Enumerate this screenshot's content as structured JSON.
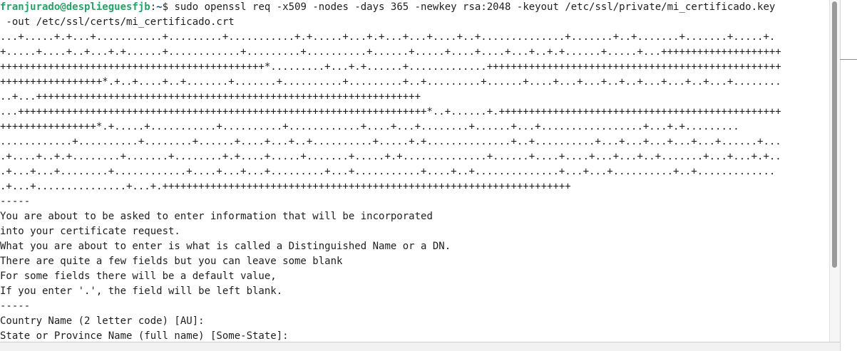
{
  "prompt": {
    "user_host": "franjurado@desplieguesfjb",
    "separator": ":",
    "path": "~",
    "symbol": "$ "
  },
  "command": {
    "line1": "sudo openssl req -x509 -nodes -days 365 -newkey rsa:2048 -keyout /etc/ssl/private/mi_certificado.key",
    "line2": " -out /etc/ssl/certs/mi_certificado.crt"
  },
  "output_lines": [
    "...+.....+.+...+...........+.........+...........+.+.....+...+.+...+...+....+..+..............+.......+..+.......+.......+.....+.",
    "+.....+....+..+...+.+......+............+.........+..........+......+.....+....+....+...+..+.+......+.....+...++++++++++++++++++++",
    "++++++++++++++++++++++++++++++++++++++++++++*.........+...+.+......+.............+++++++++++++++++++++++++++++++++++++++++++++++++",
    "+++++++++++++++++*.+..+....+..+.......+.......+..........+.........+..+.........+......+....+...+...+..+..+...+...+..+...+........",
    "..+...++++++++++++++++++++++++++++++++++++++++++++++++++++++++++++++++",
    "...++++++++++++++++++++++++++++++++++++++++++++++++++++++++++++++++++++*..+......+.+++++++++++++++++++++++++++++++++++++++++++++++",
    "++++++++++++++++*.+.....+...........+..........+............+....+...+........+......+...+.................+...+.+.........",
    "............+..........+........+......+....+...+..+..........+.....+.+..............+..+..........+...+...+...+...+...+......+...",
    ".+....+..+.+........+.......+........+.+....+.....+.......+.....+.+..............+......+....+....+...+...+..+.......+...+...+.+..",
    ".+...+...+........+............+....+...+...+.........+...+...........+....+..+..............+...+...+..........+..+.............",
    ".+...+...............+...+.++++++++++++++++++++++++++++++++++++++++++++++++++++++++++++++++++++",
    "-----",
    "You are about to be asked to enter information that will be incorporated",
    "into your certificate request.",
    "What you are about to enter is what is called a Distinguished Name or a DN.",
    "There are quite a few fields but you can leave some blank",
    "For some fields there will be a default value,",
    "If you enter '.', the field will be left blank.",
    "-----",
    "Country Name (2 letter code) [AU]:",
    "State or Province Name (full name) [Some-State]:"
  ],
  "colors": {
    "prompt_user": "#26a269",
    "prompt_path": "#12488b",
    "text": "#1e1e1e",
    "background": "#ffffff"
  }
}
